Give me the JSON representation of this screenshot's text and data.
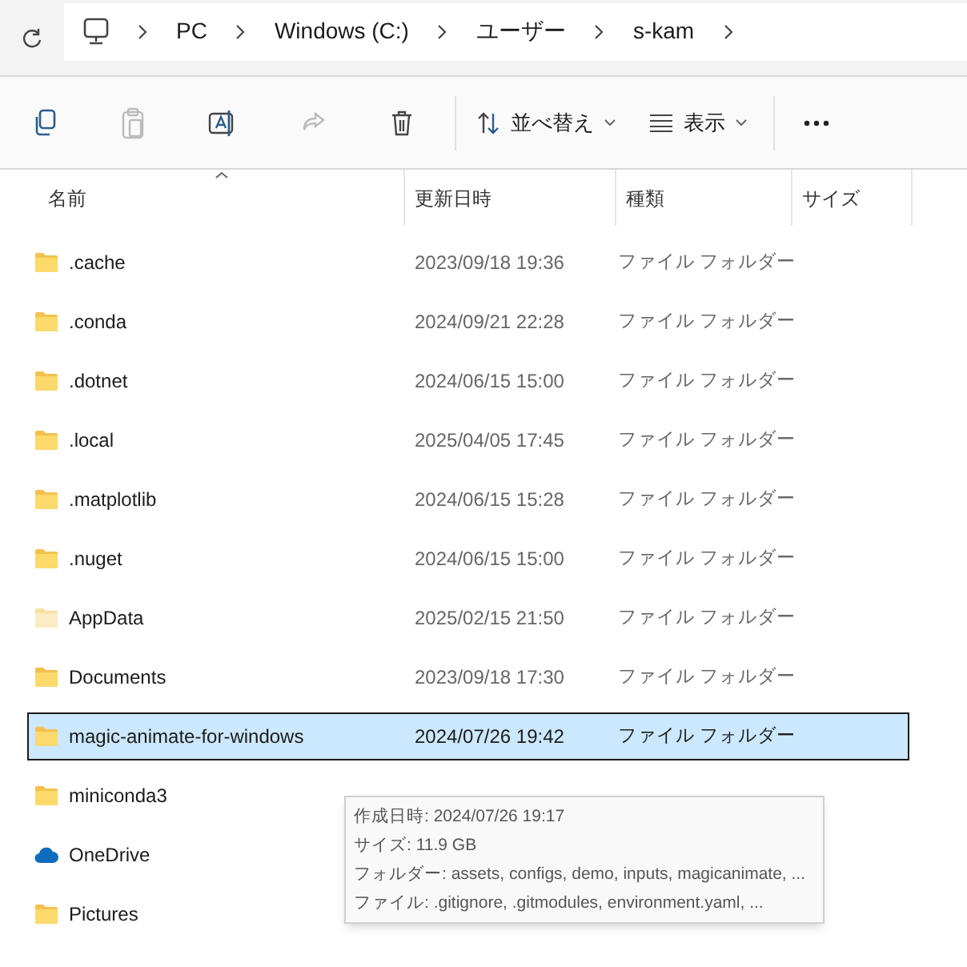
{
  "breadcrumb": [
    "PC",
    "Windows (C:)",
    "ユーザー",
    "s-kam"
  ],
  "toolbar": {
    "sort": "並べ替え",
    "view": "表示"
  },
  "columns": [
    "名前",
    "更新日時",
    "種類",
    "サイズ"
  ],
  "rows": [
    {
      "kind": "folder",
      "name": ".cache",
      "date": "2023/09/18 19:36",
      "type": "ファイル フォルダー",
      "selected": false
    },
    {
      "kind": "folder",
      "name": ".conda",
      "date": "2024/09/21 22:28",
      "type": "ファイル フォルダー",
      "selected": false
    },
    {
      "kind": "folder",
      "name": ".dotnet",
      "date": "2024/06/15 15:00",
      "type": "ファイル フォルダー",
      "selected": false
    },
    {
      "kind": "folder",
      "name": ".local",
      "date": "2025/04/05 17:45",
      "type": "ファイル フォルダー",
      "selected": false
    },
    {
      "kind": "folder",
      "name": ".matplotlib",
      "date": "2024/06/15 15:28",
      "type": "ファイル フォルダー",
      "selected": false
    },
    {
      "kind": "folder",
      "name": ".nuget",
      "date": "2024/06/15 15:00",
      "type": "ファイル フォルダー",
      "selected": false
    },
    {
      "kind": "hidden-folder",
      "name": "AppData",
      "date": "2025/02/15 21:50",
      "type": "ファイル フォルダー",
      "selected": false
    },
    {
      "kind": "folder",
      "name": "Documents",
      "date": "2023/09/18 17:30",
      "type": "ファイル フォルダー",
      "selected": false
    },
    {
      "kind": "folder",
      "name": "magic-animate-for-windows",
      "date": "2024/07/26 19:42",
      "type": "ファイル フォルダー",
      "selected": true
    },
    {
      "kind": "folder",
      "name": "miniconda3",
      "selected": false
    },
    {
      "kind": "cloud",
      "name": "OneDrive",
      "selected": false
    },
    {
      "kind": "folder",
      "name": "Pictures",
      "selected": false
    }
  ],
  "tooltip": [
    "作成日時: 2024/07/26 19:17",
    "サイズ: 11.9 GB",
    "フォルダー: assets, configs, demo, inputs, magicanimate, ...",
    "ファイル: .gitignore, .gitmodules, environment.yaml, ..."
  ]
}
